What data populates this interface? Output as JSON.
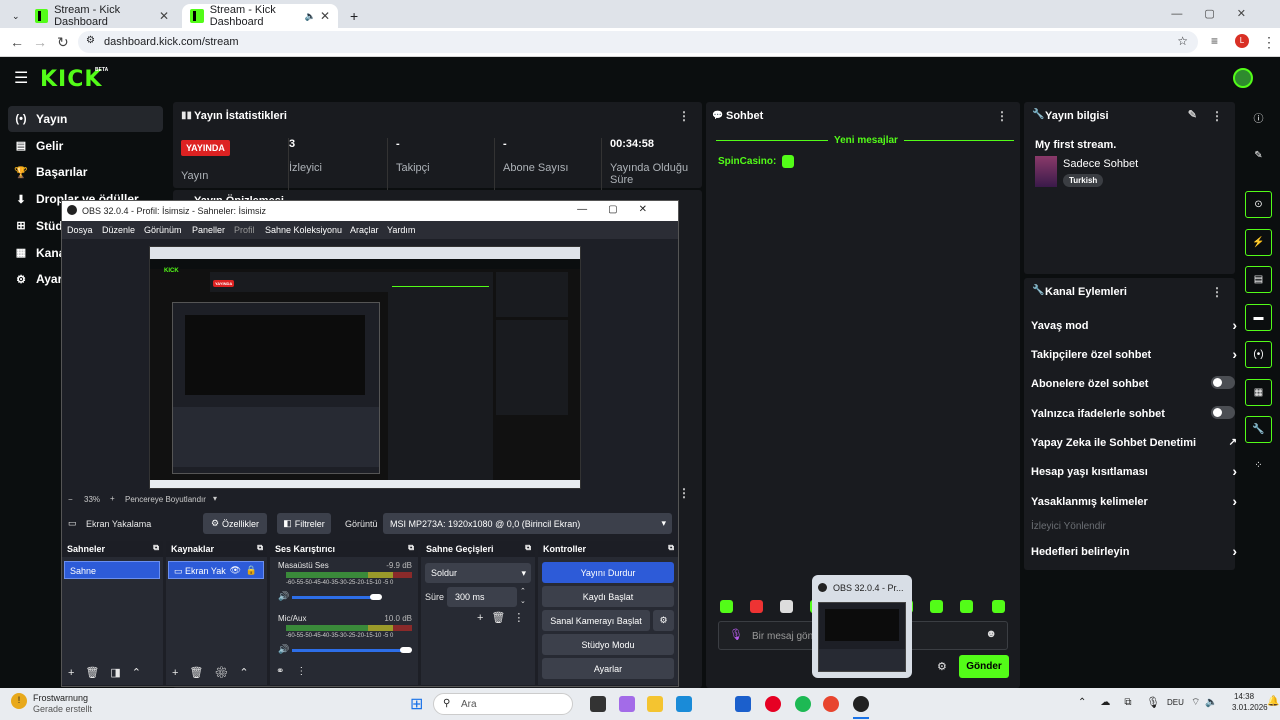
{
  "browser": {
    "tabs": [
      {
        "title": "Stream - Kick Dashboard"
      },
      {
        "title": "Stream - Kick Dashboard",
        "audio_icon": "speaker-icon"
      }
    ],
    "url": "dashboard.kick.com/stream",
    "profile_letter": "L"
  },
  "kick": {
    "logo": "KICK",
    "beta": "BETA",
    "sidebar": [
      {
        "label": "Yayın",
        "icon": "broadcast-icon",
        "active": true
      },
      {
        "label": "Gelir",
        "icon": "money-icon"
      },
      {
        "label": "Başarılar",
        "icon": "trophy-icon"
      },
      {
        "label": "Droplar ve ödüller",
        "icon": "drops-icon"
      },
      {
        "label": "Stüdy",
        "icon": "studio-icon"
      },
      {
        "label": "Kana",
        "icon": "channel-icon"
      },
      {
        "label": "Ayarl",
        "icon": "gear-icon"
      }
    ],
    "stats": {
      "title": "Yayın İstatistikleri",
      "live_badge": "YAYINDA",
      "items": [
        {
          "value": "",
          "label": "Yayın"
        },
        {
          "value": "3",
          "label": "İzleyici"
        },
        {
          "value": "-",
          "label": "Takipçi"
        },
        {
          "value": "-",
          "label": "Abone Sayısı"
        },
        {
          "value": "00:34:58",
          "label": "Yayında Olduğu Süre"
        }
      ]
    },
    "second_panel_title": "Yayın Önizlemesi",
    "chat": {
      "title": "Sohbet",
      "new_messages": "Yeni mesajlar",
      "messages": [
        {
          "user": "SpinCasino:",
          "emote": "kick-emote"
        }
      ],
      "input_placeholder": "Bir mesaj gön",
      "send_label": "Gönder"
    },
    "stream_info": {
      "title": "Yayın bilgisi",
      "stream_title": "My first stream.",
      "category": "Sadece Sohbet",
      "tag": "Turkish"
    },
    "channel_actions": {
      "title": "Kanal Eylemleri",
      "items": [
        {
          "label": "Yavaş mod",
          "control": "chevron"
        },
        {
          "label": "Takipçilere özel sohbet",
          "control": "chevron"
        },
        {
          "label": "Abonelere özel sohbet",
          "control": "toggle"
        },
        {
          "label": "Yalnızca ifadelerle sohbet",
          "control": "toggle"
        },
        {
          "label": "Yapay Zeka ile Sohbet Denetimi",
          "control": "external"
        },
        {
          "label": "Hesap yaşı kısıtlaması",
          "control": "chevron"
        },
        {
          "label": "Yasaklanmış kelimeler",
          "control": "chevron"
        },
        {
          "label": "İzleyici Yönlendir",
          "control": "disabled"
        },
        {
          "label": "Hedefleri belirleyin",
          "control": "chevron"
        }
      ]
    }
  },
  "obs": {
    "window_title": "OBS 32.0.4 - Profil: İsimsiz - Sahneler: İsimsiz",
    "menu": [
      "Dosya",
      "Düzenle",
      "Görünüm",
      "Paneller",
      "Profil",
      "Sahne Koleksiyonu",
      "Araçlar",
      "Yardım"
    ],
    "zoom": "33%",
    "fit_label": "Pencereye Boyutlandır",
    "source_name": "Ekran Yakalama",
    "properties_btn": "Özellikler",
    "filters_btn": "Filtreler",
    "display_label": "Görüntü",
    "display_value": "MSI MP273A: 1920x1080 @ 0,0 (Birincil Ekran)",
    "docks": {
      "scenes": {
        "title": "Sahneler",
        "items": [
          "Sahne"
        ]
      },
      "sources": {
        "title": "Kaynaklar",
        "items": [
          "Ekran Yak"
        ]
      },
      "mixer": {
        "title": "Ses Karıştırıcı",
        "channels": [
          {
            "name": "Masaüstü Ses",
            "db": "-9.9 dB",
            "level": 0.8
          },
          {
            "name": "Mic/Aux",
            "db": "10.0 dB",
            "level": 0.95
          }
        ],
        "scale": "-60-55-50-45-40-35-30-25-20-15-10 -5 0"
      },
      "transitions": {
        "title": "Sahne Geçişleri",
        "type": "Soldur",
        "duration_label": "Süre",
        "duration": "300 ms"
      },
      "controls": {
        "title": "Kontroller",
        "buttons": [
          "Yayını Durdur",
          "Kaydı Başlat",
          "Sanal Kamerayı Başlat",
          "Stüdyo Modu",
          "Ayarlar"
        ]
      }
    }
  },
  "thumbnail_popup": {
    "title": "OBS 32.0.4 - Pr..."
  },
  "taskbar": {
    "notification_title": "Frostwarnung",
    "notification_sub": "Gerade erstellt",
    "search_placeholder": "Ara",
    "lang": "DEU",
    "time": "14:38",
    "date": "3.01.2026"
  },
  "colors": {
    "accent": "#53fc18",
    "live": "#dd2222",
    "obs_blue": "#2d5bd8"
  }
}
